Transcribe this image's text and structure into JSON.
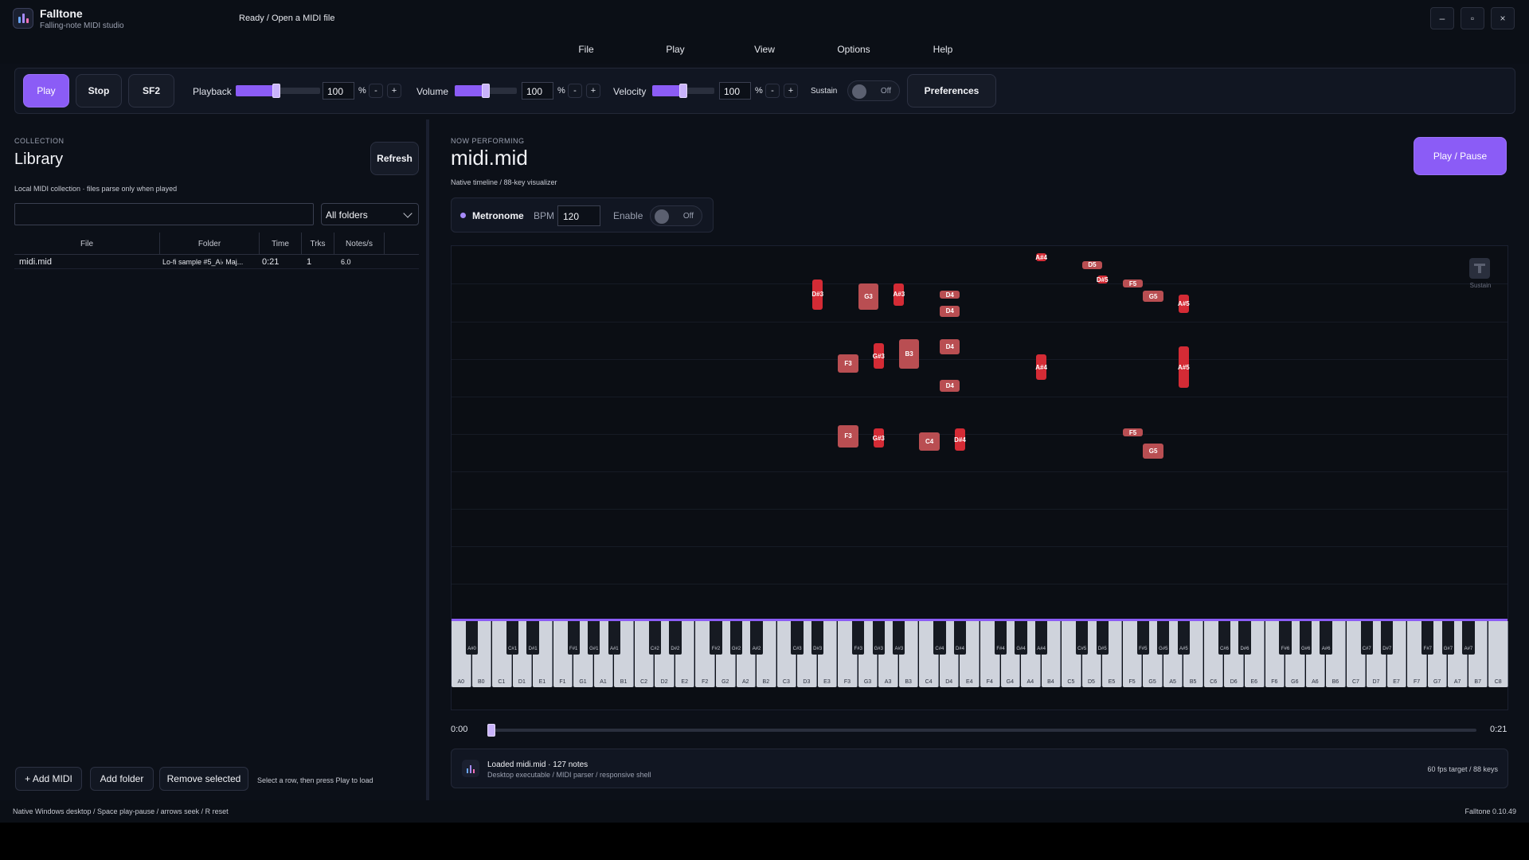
{
  "app": {
    "name": "Falltone",
    "subtitle": "Falling-note MIDI studio",
    "status": "Ready / Open a MIDI file",
    "version": "Falltone 0.10.49"
  },
  "window_controls": {
    "minimize": "–",
    "maximize": "▫",
    "close": "×"
  },
  "menu": [
    "File",
    "Play",
    "View",
    "Options",
    "Help"
  ],
  "toolbar": {
    "play": "Play",
    "stop": "Stop",
    "sf2": "SF2",
    "playback": {
      "label": "Playback",
      "value": "100",
      "unit": "%",
      "level": 0.5
    },
    "volume": {
      "label": "Volume",
      "value": "100",
      "unit": "%",
      "level": 0.5
    },
    "velocity": {
      "label": "Velocity",
      "value": "100",
      "unit": "%",
      "level": 0.5
    },
    "minus": "-",
    "plus": "+",
    "sustain": {
      "label": "Sustain",
      "state": "Off"
    },
    "preferences": "Preferences"
  },
  "library": {
    "eyebrow": "COLLECTION",
    "title": "Library",
    "refresh": "Refresh",
    "description": "Local MIDI collection · files parse only when played",
    "search_value": "",
    "folder_select": "All folders",
    "columns": [
      "File",
      "Folder",
      "Time",
      "Trks",
      "Notes/s"
    ],
    "rows": [
      {
        "file": "midi.mid",
        "folder": "Lo-fi sample #5_A♭ Maj...",
        "time": "0:21",
        "trks": "1",
        "notes": "6.0"
      }
    ],
    "add_midi": "+ Add MIDI",
    "add_folder": "Add folder",
    "remove": "Remove selected",
    "hint": "Select a row, then press Play to load"
  },
  "now": {
    "eyebrow": "NOW PERFORMING",
    "title": "midi.mid",
    "subtitle": "Native timeline / 88-key visualizer",
    "play_pause": "Play / Pause",
    "metronome": {
      "label": "Metronome",
      "bpm_label": "BPM",
      "bpm": "120",
      "enable_label": "Enable",
      "state": "Off"
    },
    "sustain_indicator": "Sustain",
    "time_start": "0:00",
    "time_end": "0:21",
    "seek_position": 0,
    "loaded": "Loaded midi.mid · 127 notes",
    "loaded_sub": "Desktop executable / MIDI parser / responsive shell",
    "fps": "60 fps target / 88 keys"
  },
  "statusbar": {
    "left": "Native Windows desktop / Space play-pause / arrows seek / R reset"
  },
  "colors": {
    "accent": "#8b5cf6",
    "note": "#d42b35",
    "note_wide": "#b94e52"
  },
  "notes": [
    {
      "n": "D#3",
      "t": 0.09,
      "d": 0.08,
      "s": "bl"
    },
    {
      "n": "G3",
      "t": 0.1,
      "d": 0.07,
      "s": "wide"
    },
    {
      "n": "A#3",
      "t": 0.1,
      "d": 0.06,
      "s": "bl"
    },
    {
      "n": "D4",
      "t": 0.12,
      "d": 0.02,
      "s": "wide"
    },
    {
      "n": "D4",
      "t": 0.16,
      "d": 0.03,
      "s": "wide"
    },
    {
      "n": "D4",
      "t": 0.25,
      "d": 0.04,
      "s": "wide"
    },
    {
      "n": "D4",
      "t": 0.36,
      "d": 0.03,
      "s": "wide"
    },
    {
      "n": "F3",
      "t": 0.29,
      "d": 0.05,
      "s": "wide"
    },
    {
      "n": "G#3",
      "t": 0.26,
      "d": 0.07,
      "s": "bl"
    },
    {
      "n": "B3",
      "t": 0.25,
      "d": 0.08,
      "s": "wide"
    },
    {
      "n": "A#4",
      "t": 0.29,
      "d": 0.07,
      "s": "bl"
    },
    {
      "n": "A#4",
      "t": 0.02,
      "d": 0.01,
      "s": "bl"
    },
    {
      "n": "D5",
      "t": 0.04,
      "d": 0.02,
      "s": "wide"
    },
    {
      "n": "D#5",
      "t": 0.08,
      "d": 0.01,
      "s": "bl"
    },
    {
      "n": "F5",
      "t": 0.09,
      "d": 0.02,
      "s": "wide"
    },
    {
      "n": "G5",
      "t": 0.12,
      "d": 0.03,
      "s": "wide"
    },
    {
      "n": "A#5",
      "t": 0.13,
      "d": 0.05,
      "s": "bl"
    },
    {
      "n": "A#5",
      "t": 0.27,
      "d": 0.11,
      "s": "bl"
    },
    {
      "n": "F3",
      "t": 0.48,
      "d": 0.06,
      "s": "wide"
    },
    {
      "n": "G#3",
      "t": 0.49,
      "d": 0.05,
      "s": "bl"
    },
    {
      "n": "C4",
      "t": 0.5,
      "d": 0.05,
      "s": "wide"
    },
    {
      "n": "D#4",
      "t": 0.49,
      "d": 0.06,
      "s": "bl"
    },
    {
      "n": "F5",
      "t": 0.49,
      "d": 0.02,
      "s": "wide"
    },
    {
      "n": "G5",
      "t": 0.53,
      "d": 0.04,
      "s": "wide"
    }
  ]
}
